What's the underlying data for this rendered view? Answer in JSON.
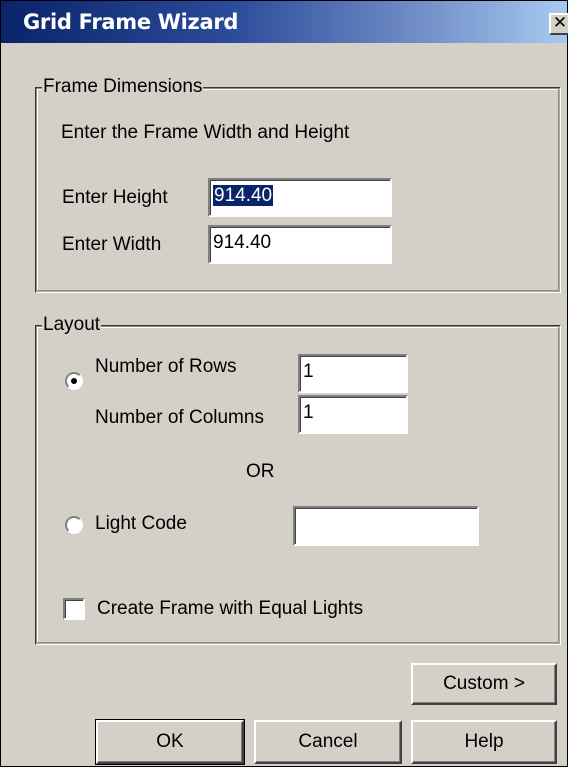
{
  "window": {
    "title": "Grid Frame Wizard",
    "close_glyph": "✕"
  },
  "frame_dimensions": {
    "group_label": "Frame Dimensions",
    "instruction": "Enter the Frame Width and Height",
    "height_label": "Enter Height",
    "height_value": "914.40",
    "width_label": "Enter Width",
    "width_value": "914.40"
  },
  "layout": {
    "group_label": "Layout",
    "rows_label": "Number of Rows",
    "rows_value": "1",
    "columns_label": "Number of Columns",
    "columns_value": "1",
    "or_text": "OR",
    "light_code_label": "Light Code",
    "light_code_value": "",
    "equal_lights_label": "Create Frame with Equal Lights",
    "rows_columns_selected": true,
    "equal_lights_checked": false
  },
  "buttons": {
    "custom": "Custom >",
    "ok": "OK",
    "cancel": "Cancel",
    "help": "Help"
  },
  "colors": {
    "title_gradient_start": "#0a246a",
    "title_gradient_end": "#a6caf0",
    "face": "#d4d0c8",
    "selection": "#0a246a"
  }
}
